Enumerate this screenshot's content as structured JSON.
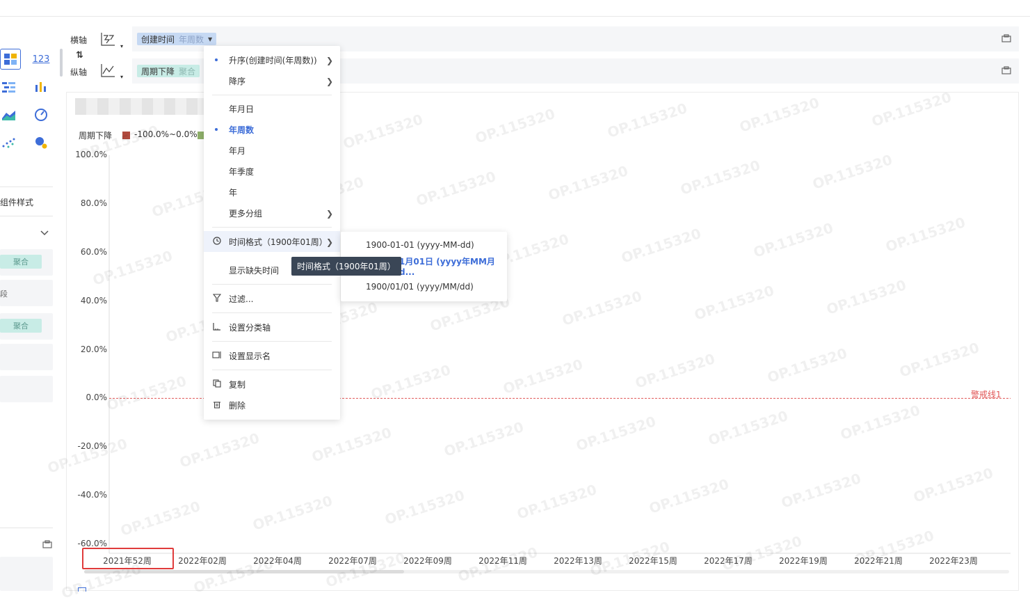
{
  "shelves": {
    "x_axis_label": "横轴",
    "y_axis_label": "纵轴",
    "x_pill": {
      "field": "创建时间",
      "sub": "年周数"
    },
    "y_pill": {
      "field": "周期下降",
      "sub": "聚合"
    }
  },
  "left_panel": {
    "chart_number_icon": "123",
    "component_style_label": "组件样式",
    "agg_tag_1": "聚合",
    "partial_label": "段",
    "agg_tag_2": "聚合"
  },
  "chart": {
    "legend_title": "周期下降",
    "legend_range": "-100.0%~0.0%",
    "warning_line_label": "警戒线1",
    "watermark": "OP.115320"
  },
  "chart_data": {
    "type": "bar",
    "categories": [
      "2021年52周",
      "2022年02周",
      "2022年04周",
      "2022年07周",
      "2022年09周",
      "2022年11周",
      "2022年13周",
      "2022年15周",
      "2022年17周",
      "2022年19周",
      "2022年21周",
      "2022年23周"
    ],
    "y_ticks": [
      "100.0%",
      "80.0%",
      "60.0%",
      "40.0%",
      "20.0%",
      "0.0%",
      "-20.0%",
      "-40.0%",
      "-60.0%"
    ],
    "ylim": [
      -60,
      100
    ],
    "reference_line": {
      "label": "警戒线1",
      "value": 0
    },
    "legend": [
      {
        "name": "周期下降",
        "range": "-100.0%~0.0%",
        "color": "#b04a3e"
      }
    ]
  },
  "context_menu": {
    "items": [
      {
        "label": "升序(创建时间(年周数))",
        "dot": true,
        "arrow": true
      },
      {
        "label": "降序",
        "arrow": true
      },
      {
        "label": "年月日"
      },
      {
        "label": "年周数",
        "dot": true,
        "active": true
      },
      {
        "label": "年月"
      },
      {
        "label": "年季度"
      },
      {
        "label": "年"
      },
      {
        "label": "更多分组",
        "arrow": true
      },
      {
        "label": "时间格式（1900年01周）",
        "arrow": true,
        "icon": "clock-icon"
      },
      {
        "label": "显示缺失时间"
      },
      {
        "label": "过滤...",
        "icon": "filter-icon"
      },
      {
        "label": "设置分类轴",
        "icon": "axis-icon"
      },
      {
        "label": "设置显示名",
        "icon": "rename-icon"
      },
      {
        "label": "复制",
        "icon": "copy-icon"
      },
      {
        "label": "删除",
        "icon": "trash-icon"
      }
    ]
  },
  "submenu": {
    "items": [
      {
        "label": "1900-01-01 (yyyy-MM-dd)"
      },
      {
        "label": "1月01日 (yyyy年MM月d...",
        "active": true
      },
      {
        "label": "1900/01/01 (yyyy/MM/dd)"
      }
    ]
  },
  "tooltip": {
    "text": "时间格式（1900年01周）"
  },
  "colors": {
    "accent": "#3d6dd8",
    "highlight_box": "#e03b3b",
    "legend_red": "#b04a3e",
    "legend_green": "#8fb06a"
  }
}
